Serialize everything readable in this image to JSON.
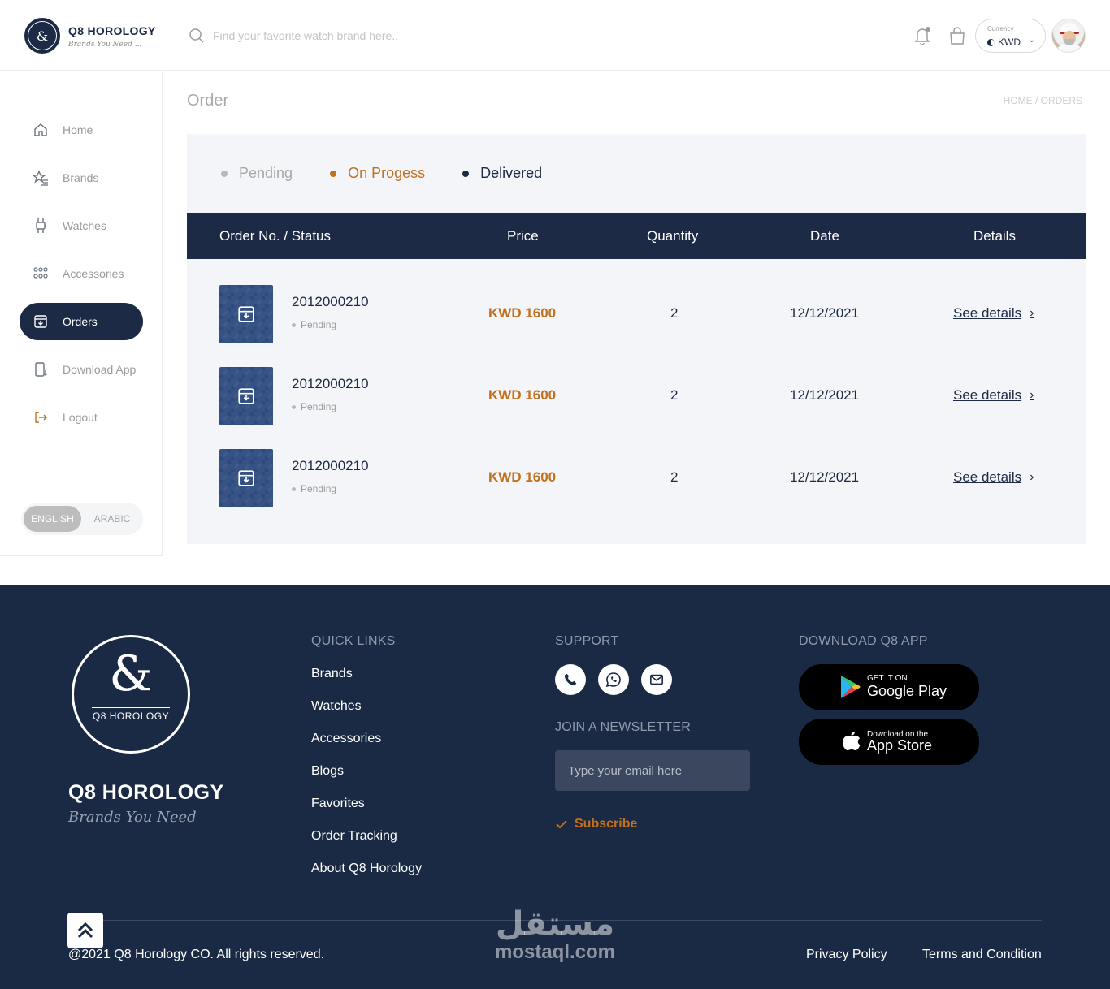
{
  "header": {
    "brand_name": "Q8 HOROLOGY",
    "brand_tagline": "Brands You Need ...",
    "search_placeholder": "Find your favorite watch brand here..",
    "currency_label": "Currency",
    "currency_value": "KWD"
  },
  "sidebar": {
    "items": [
      {
        "label": "Home",
        "icon": "home-icon"
      },
      {
        "label": "Brands",
        "icon": "star-list-icon"
      },
      {
        "label": "Watches",
        "icon": "watch-icon"
      },
      {
        "label": "Accessories",
        "icon": "accessories-icon"
      },
      {
        "label": "Orders",
        "icon": "order-box-icon",
        "active": true
      },
      {
        "label": "Download App",
        "icon": "phone-download-icon"
      },
      {
        "label": "Logout",
        "icon": "logout-icon"
      }
    ],
    "lang_english": "ENGLISH",
    "lang_arabic": "ARABIC"
  },
  "main": {
    "title": "Order",
    "breadcrumb": "HOME / ORDERS",
    "filters": [
      {
        "label": "Pending",
        "color": "#b9b9b9"
      },
      {
        "label": "On Progess",
        "color": "#c0701e"
      },
      {
        "label": "Delivered",
        "color": "#1c2a45"
      }
    ],
    "columns": [
      "Order No. / Status",
      "Price",
      "Quantity",
      "Date",
      "Details"
    ],
    "orders": [
      {
        "number": "2012000210",
        "status": "Pending",
        "price": "KWD 1600",
        "quantity": "2",
        "date": "12/12/2021",
        "details": "See details"
      },
      {
        "number": "2012000210",
        "status": "Pending",
        "price": "KWD 1600",
        "quantity": "2",
        "date": "12/12/2021",
        "details": "See details"
      },
      {
        "number": "2012000210",
        "status": "Pending",
        "price": "KWD 1600",
        "quantity": "2",
        "date": "12/12/2021",
        "details": "See details"
      }
    ]
  },
  "footer": {
    "logo_text": "Q8 HOROLOGY",
    "brand_name": "Q8 HOROLOGY",
    "brand_tagline": "Brands You Need",
    "quick_links_heading": "QUICK LINKS",
    "quick_links": [
      "Brands",
      "Watches",
      "Accessories",
      "Blogs",
      "Favorites",
      "Order Tracking",
      "About Q8 Horology"
    ],
    "support_heading": "SUPPORT",
    "newsletter_heading": "JOIN A NEWSLETTER",
    "email_placeholder": "Type your email here",
    "subscribe_label": "Subscribe",
    "download_heading": "DOWNLOAD Q8 APP",
    "google_small": "GET IT ON",
    "google_big": "Google Play",
    "apple_small": "Download on the",
    "apple_big": "App Store",
    "copyright": "@2021 Q8 Horology CO. All rights reserved.",
    "privacy": "Privacy Policy",
    "terms": "Terms and Condition",
    "watermark_ar": "مستقل",
    "watermark_en": "mostaql.com"
  },
  "colors": {
    "primary": "#1c2a45",
    "accent": "#c0701e",
    "footer_bg": "#1b2a44"
  }
}
